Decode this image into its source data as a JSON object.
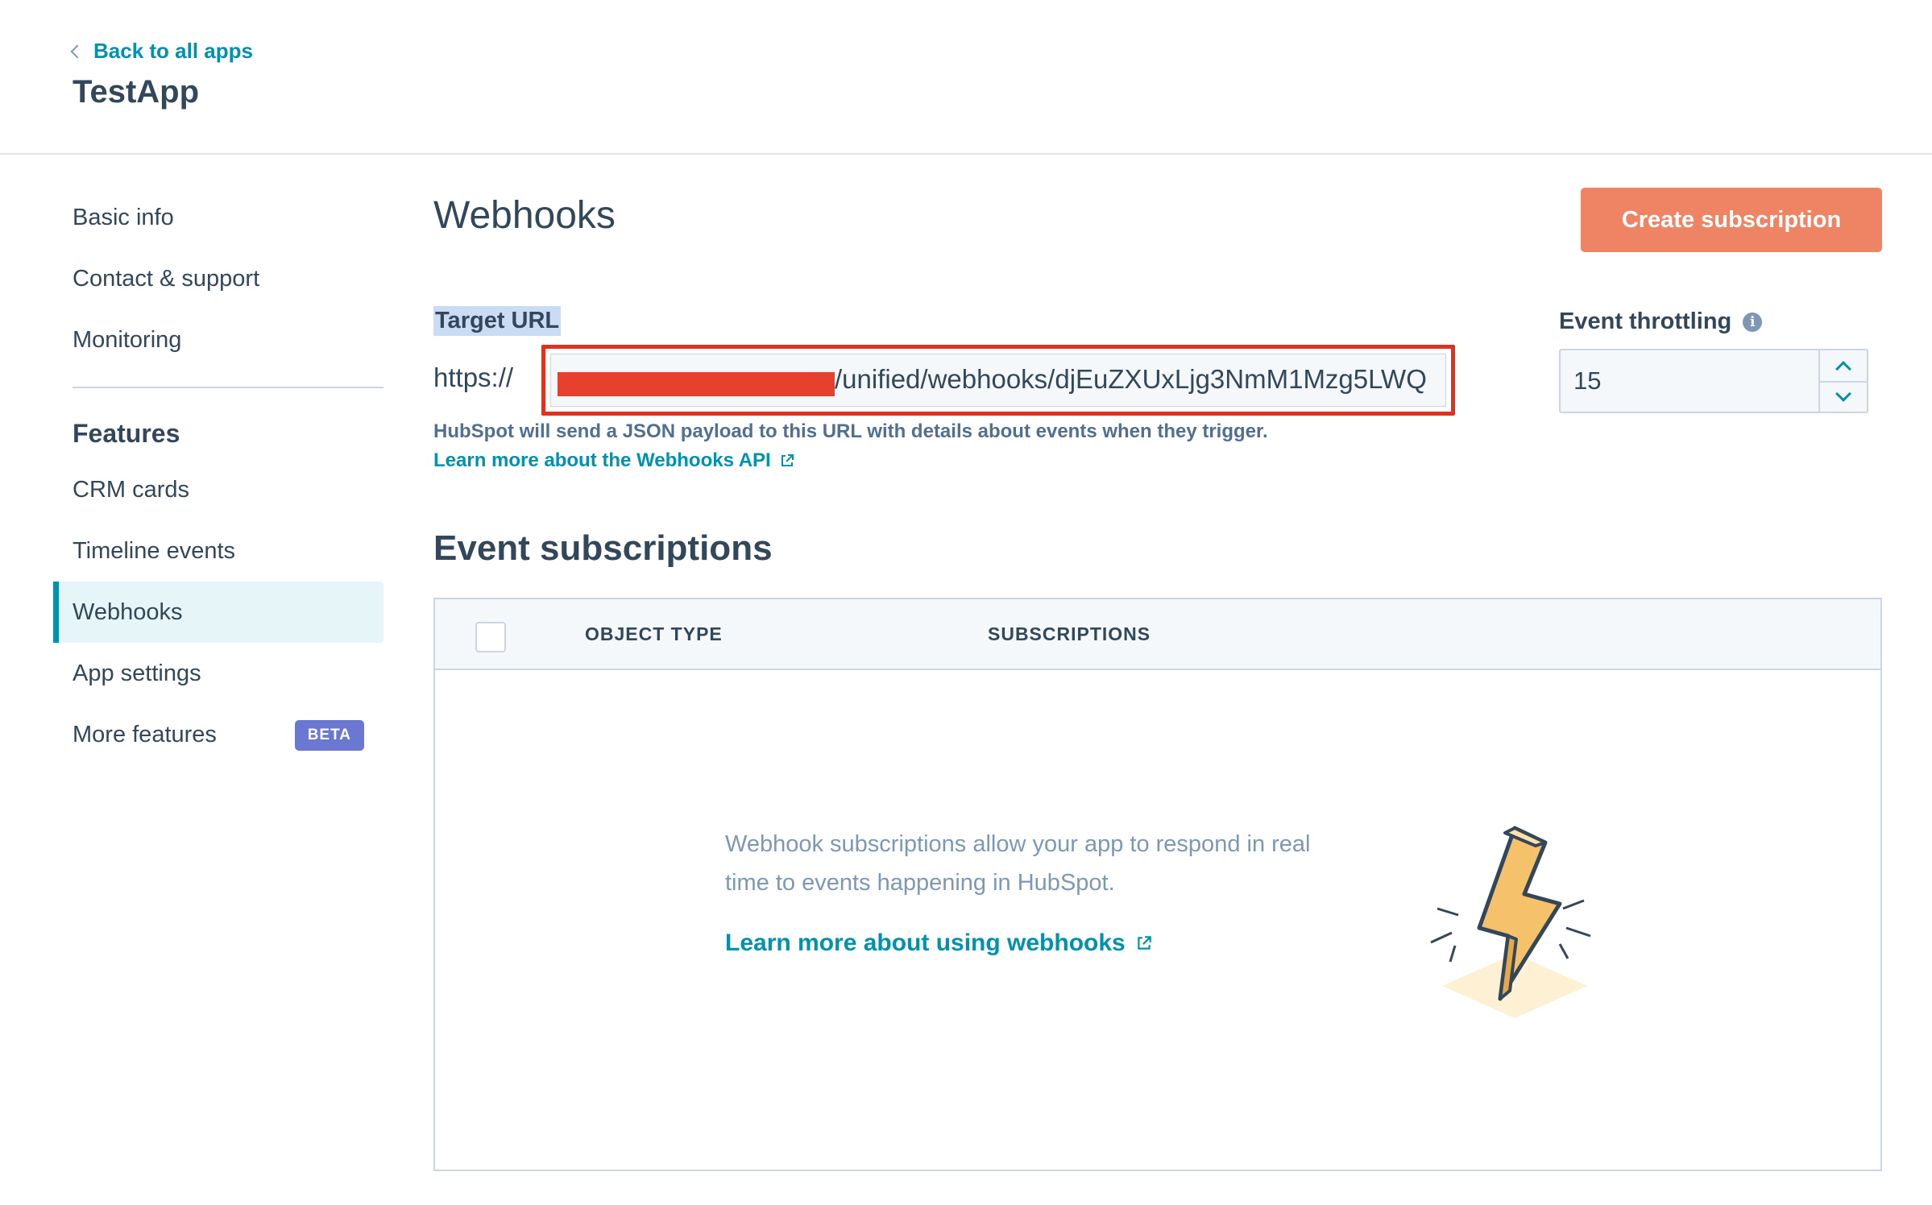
{
  "header": {
    "back_label": "Back to all apps",
    "app_title": "TestApp"
  },
  "sidebar": {
    "items": [
      {
        "label": "Basic info"
      },
      {
        "label": "Contact & support"
      },
      {
        "label": "Monitoring"
      }
    ],
    "features_heading": "Features",
    "feature_items": [
      {
        "label": "CRM cards"
      },
      {
        "label": "Timeline events"
      },
      {
        "label": "Webhooks",
        "active": true
      },
      {
        "label": "App settings"
      },
      {
        "label": "More features",
        "badge": "BETA"
      }
    ]
  },
  "main": {
    "title": "Webhooks",
    "create_button": "Create subscription",
    "target_url": {
      "label": "Target URL",
      "prefix": "https://",
      "value": "/unified/webhooks/djEuZXUxLjg3NmM1Mzg5LWQ",
      "help_text": "HubSpot will send a JSON payload to this URL with details about events when they trigger.",
      "learn_more": "Learn more about the Webhooks API"
    },
    "throttling": {
      "label": "Event throttling",
      "value": "15"
    },
    "subscriptions": {
      "heading": "Event subscriptions",
      "columns": [
        "OBJECT TYPE",
        "SUBSCRIPTIONS"
      ],
      "empty_text": "Webhook subscriptions allow your app to respond in real time to events happening in HubSpot.",
      "empty_link": "Learn more about using webhooks"
    }
  },
  "colors": {
    "accent": "#0091ae",
    "primary_button": "#ef8465",
    "text": "#33475b",
    "badge": "#6a78d1",
    "redaction": "#e8402e"
  }
}
